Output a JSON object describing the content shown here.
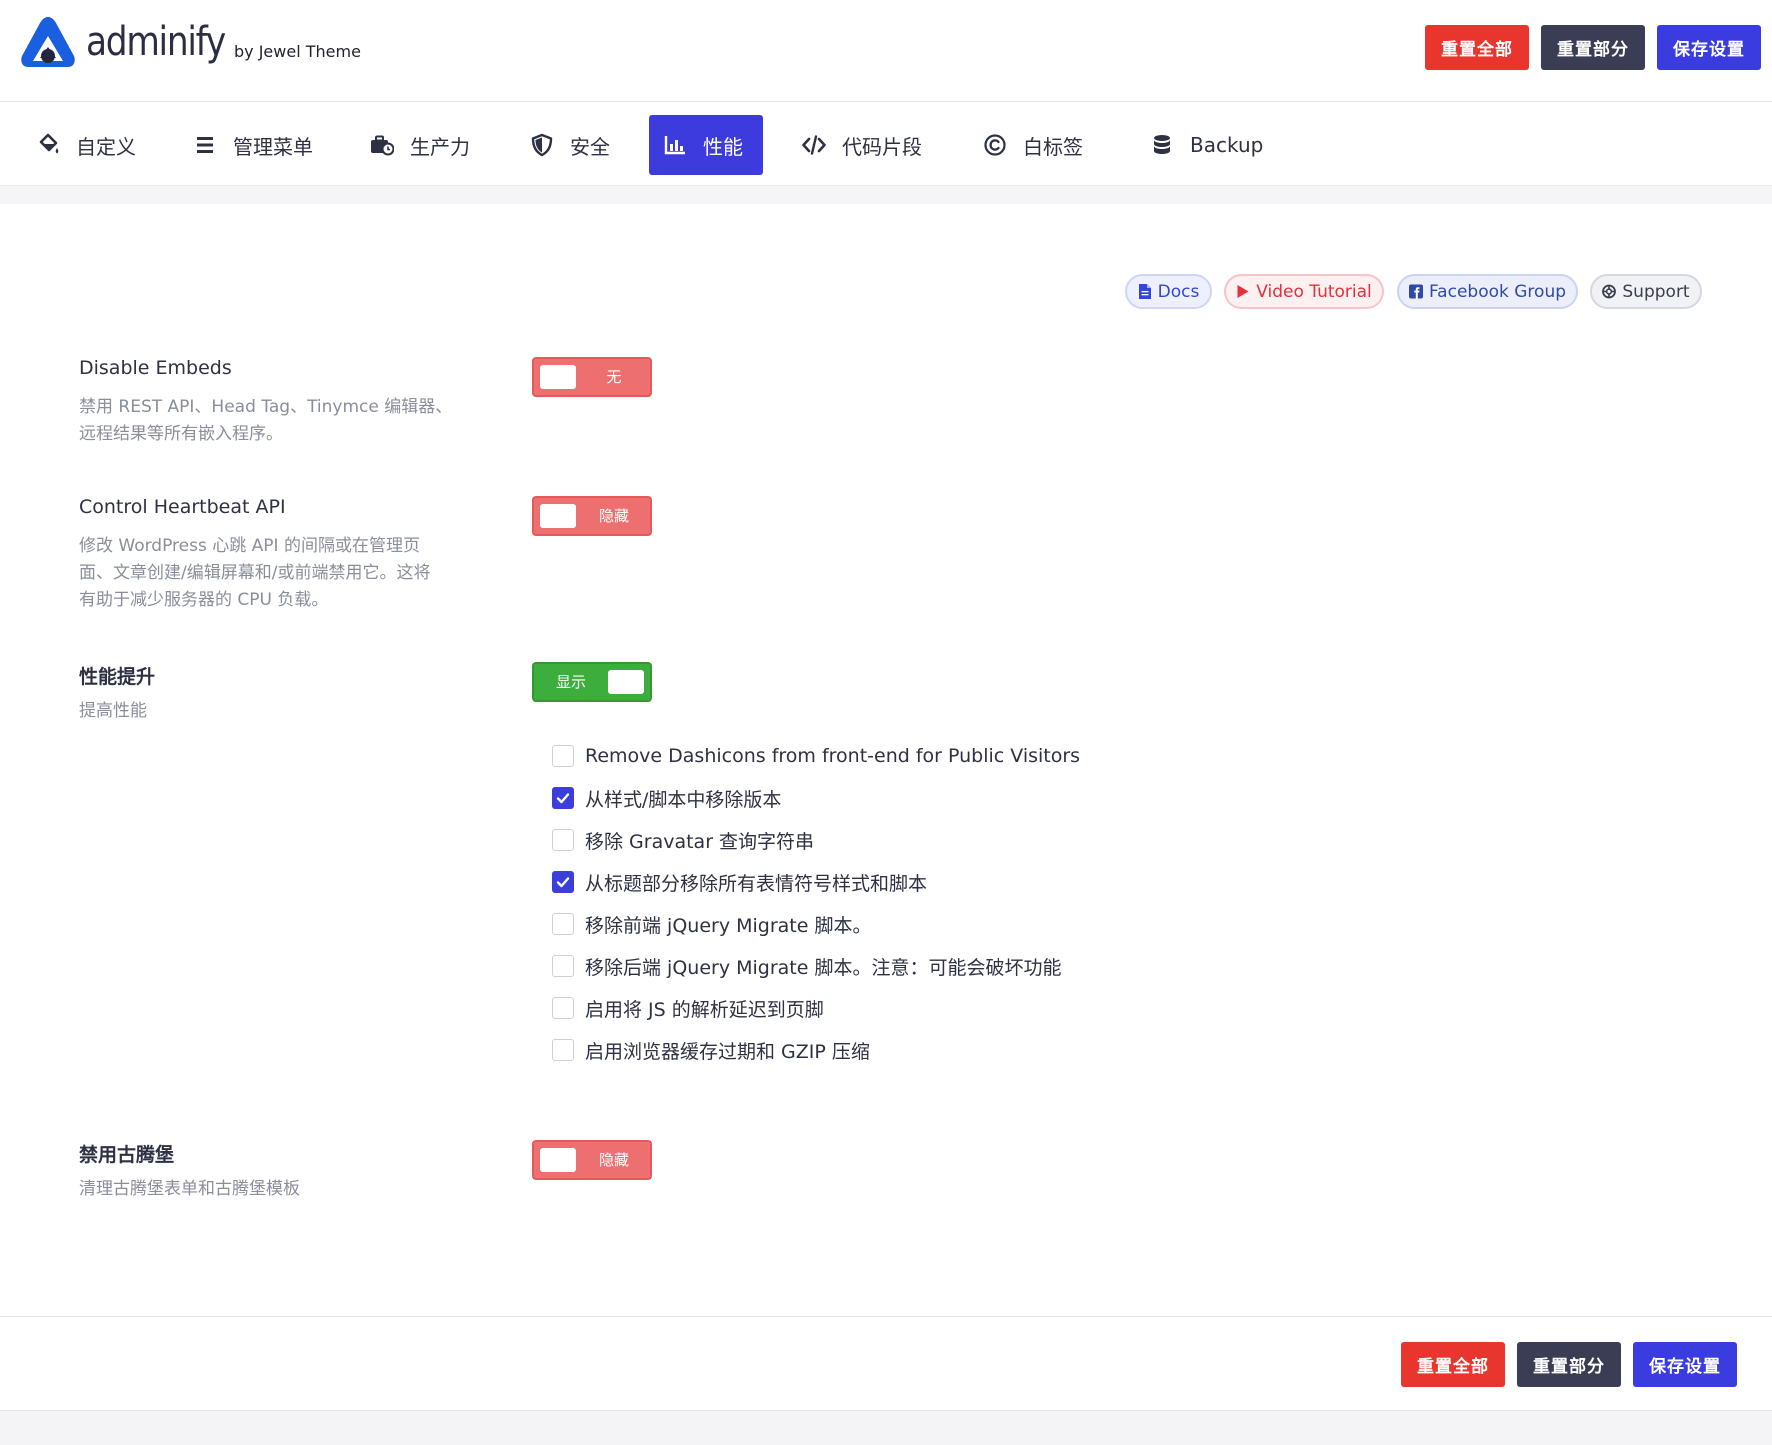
{
  "brand": {
    "name": "adminify",
    "byline": "by Jewel Theme",
    "accent": "#3d3bde",
    "logo_color": "#1a5fe0"
  },
  "actions": {
    "reset_all": "重置全部",
    "reset_section": "重置部分",
    "save": "保存设置"
  },
  "tabs": [
    {
      "label": "自定义",
      "icon": "paint-bucket-icon"
    },
    {
      "label": "管理菜单",
      "icon": "menu-list-icon"
    },
    {
      "label": "生产力",
      "icon": "briefcase-clock-icon"
    },
    {
      "label": "安全",
      "icon": "shield-icon"
    },
    {
      "label": "性能",
      "icon": "bar-chart-icon",
      "active": true
    },
    {
      "label": "代码片段",
      "icon": "code-icon"
    },
    {
      "label": "白标签",
      "icon": "copyright-icon"
    },
    {
      "label": "Backup",
      "icon": "database-icon"
    }
  ],
  "help_links": {
    "docs": "Docs",
    "video": "Video Tutorial",
    "facebook": "Facebook Group",
    "support": "Support"
  },
  "settings": {
    "disable_embeds": {
      "title": "Disable Embeds",
      "desc_line1": "禁用 REST API、Head Tag、Tinymce 编辑器、",
      "desc_line2": "远程结果等所有嵌入程序。",
      "toggle_label": "无",
      "enabled": false
    },
    "heartbeat": {
      "title": "Control Heartbeat API",
      "desc_line1": "修改 WordPress 心跳 API 的间隔或在管理页",
      "desc_line2": "面、文章创建/编辑屏幕和/或前端禁用它。这将",
      "desc_line3": "有助于减少服务器的 CPU 负载。",
      "toggle_label": "隐藏",
      "enabled": false
    },
    "performance": {
      "title": "性能提升",
      "desc": "提高性能",
      "toggle_label": "显示",
      "enabled": true,
      "options": [
        {
          "label": "Remove Dashicons from front-end for Public Visitors",
          "checked": false
        },
        {
          "label": "从样式/脚本中移除版本",
          "checked": true
        },
        {
          "label": "移除 Gravatar 查询字符串",
          "checked": false
        },
        {
          "label": "从标题部分移除所有表情符号样式和脚本",
          "checked": true
        },
        {
          "label": "移除前端 jQuery Migrate 脚本。",
          "checked": false
        },
        {
          "label": "移除后端 jQuery Migrate 脚本。注意：可能会破坏功能",
          "checked": false
        },
        {
          "label": "启用将 JS 的解析延迟到页脚",
          "checked": false
        },
        {
          "label": "启用浏览器缓存过期和 GZIP 压缩",
          "checked": false
        }
      ]
    },
    "gutenberg": {
      "title": "禁用古腾堡",
      "desc": "清理古腾堡表单和古腾堡模板",
      "toggle_label": "隐藏",
      "enabled": false
    }
  }
}
